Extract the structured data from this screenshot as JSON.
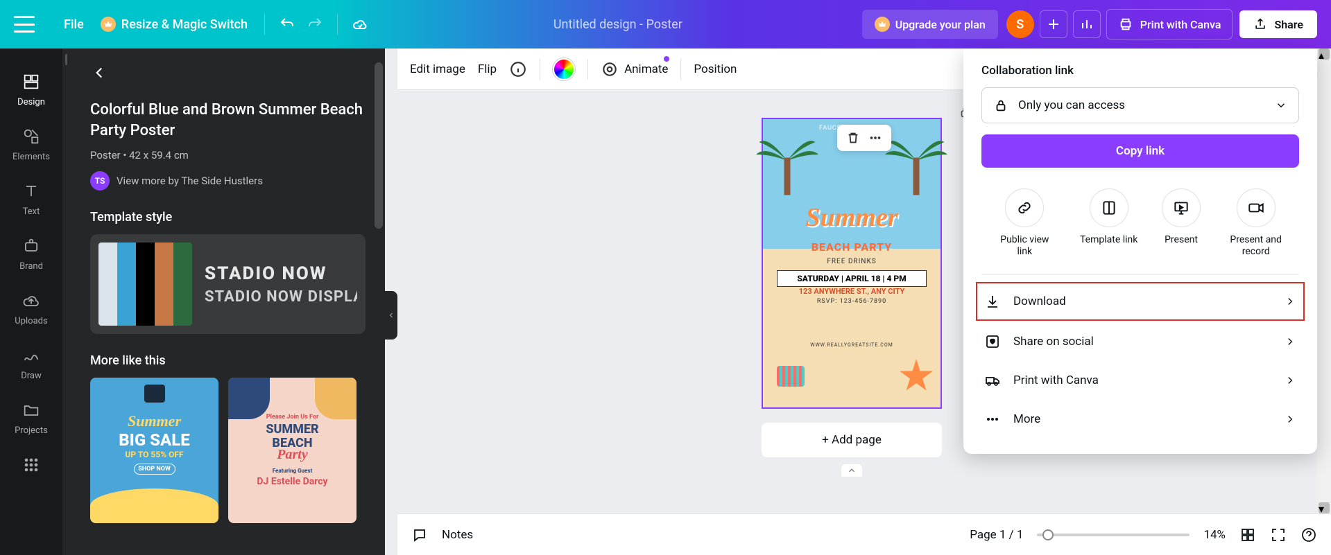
{
  "topbar": {
    "file": "File",
    "resize": "Resize & Magic Switch",
    "title": "Untitled design - Poster",
    "upgrade": "Upgrade your plan",
    "avatar_initial": "S",
    "print": "Print with Canva",
    "share": "Share"
  },
  "sidebar": {
    "items": [
      {
        "label": "Design"
      },
      {
        "label": "Elements"
      },
      {
        "label": "Text"
      },
      {
        "label": "Brand"
      },
      {
        "label": "Uploads"
      },
      {
        "label": "Draw"
      },
      {
        "label": "Projects"
      }
    ]
  },
  "panel": {
    "title": "Colorful Blue and Brown Summer Beach Party Poster",
    "meta": "Poster • 42 x 59.4 cm",
    "author_badge": "TS",
    "author_text": "View more by The Side Hustlers",
    "style_heading": "Template style",
    "font_line1": "STADIO NOW",
    "font_line2": "STADIO NOW DISPLAY",
    "palette": [
      "#d9e5ea",
      "#3ba3d4",
      "#000000",
      "#c87845",
      "#2d6b3f"
    ],
    "more_heading": "More like this",
    "thumb1": {
      "line1": "Summer",
      "line2": "BIG SALE",
      "line3": "UP TO 55% OFF",
      "line4": "SHOP NOW"
    },
    "thumb2": {
      "line1": "Please Join Us For",
      "line2": "SUMMER",
      "line3": "BEACH",
      "line4": "Party",
      "guest": "Featuring Guest",
      "dj": "DJ Estelle Darcy"
    }
  },
  "toolbar": {
    "edit_image": "Edit image",
    "flip": "Flip",
    "animate": "Animate",
    "position": "Position"
  },
  "poster": {
    "hdr": "FAUCET & FRIENDS",
    "title": "Summer",
    "subtitle": "BEACH PARTY",
    "drinks": "FREE DRINKS",
    "date": "SATURDAY | APRIL 18 | 4 PM",
    "address": "123 ANYWHERE ST., ANY CITY",
    "rsvp": "RSVP: 123-456-7890",
    "site": "WWW.REALLYGREATSITE.COM"
  },
  "canvas": {
    "add_page": "+ Add page"
  },
  "share_panel": {
    "collab_heading": "Collaboration link",
    "access_text": "Only you can access",
    "copy_link": "Copy link",
    "options": [
      {
        "label": "Public view link"
      },
      {
        "label": "Template link"
      },
      {
        "label": "Present"
      },
      {
        "label": "Present and record"
      }
    ],
    "menu": [
      {
        "label": "Download"
      },
      {
        "label": "Share on social"
      },
      {
        "label": "Print with Canva"
      },
      {
        "label": "More"
      }
    ]
  },
  "bottombar": {
    "notes": "Notes",
    "page_info": "Page 1 / 1",
    "zoom": "14%"
  }
}
